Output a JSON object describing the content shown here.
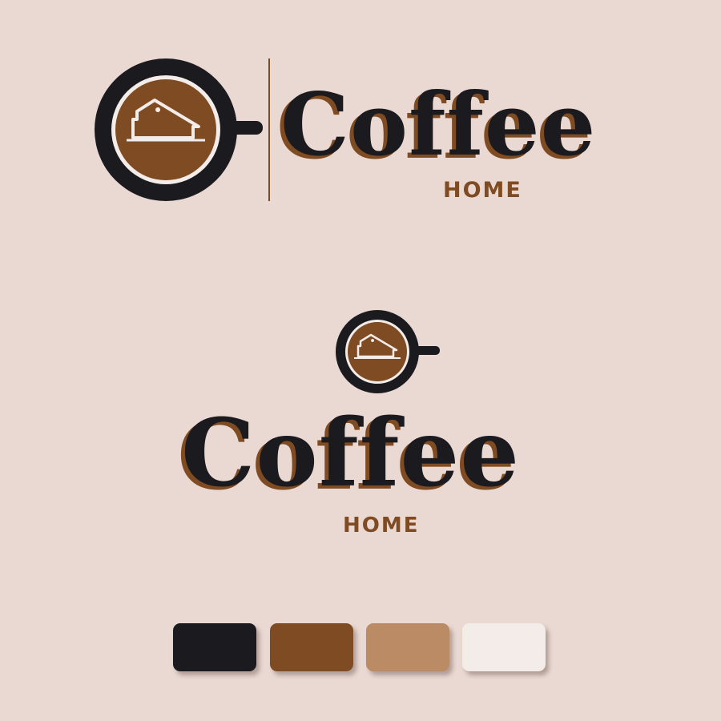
{
  "brand": {
    "name": "Coffee",
    "subtitle": "HOME",
    "logo_icon": "coffee-cup-house-icon"
  },
  "colors": {
    "background": "#ead9d3",
    "dark": "#1b1a1e",
    "brown": "#7f4b22",
    "tan": "#ba8b65",
    "cream": "#f3ece8"
  },
  "palette": [
    "#1b1a1e",
    "#7f4b22",
    "#ba8b65",
    "#f3ece8"
  ]
}
